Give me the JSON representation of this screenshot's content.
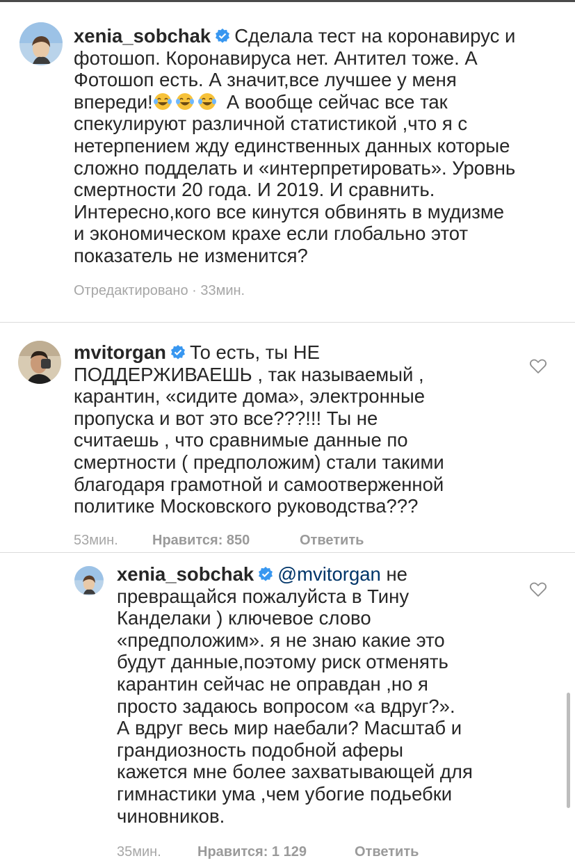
{
  "comments": [
    {
      "username": "xenia_sobchak",
      "lines": [
        "Сделала тест на коронавирус и",
        "фотошоп.  Коронавируса нет. Антител тоже. А",
        "Фотошоп есть. А значит,все лучшее  у меня",
        "впереди!",
        "А вообще сейчас все так",
        "спекулируют различной статистикой ,что я с",
        "нетерпением жду единственных данных которые",
        "сложно подделать и «интерпретировать». Уровнь",
        "смертности 20 года. И 2019. И сравнить.",
        "Интересно,кого  все кинутся обвинять в мудизме",
        "и экономическом крахе если глобально этот",
        "показатель  не изменится?"
      ],
      "meta": "Отредактировано · 33мин."
    },
    {
      "username": "mvitorgan",
      "lines": [
        "То есть, ты НЕ",
        "ПОДДЕРЖИВАЕШЬ , так называемый ,",
        "карантин, «сидите дома», электронные",
        "пропуска и вот это все???!!! Ты не",
        "считаешь , что сравнимые данные по",
        "смертности ( предположим) стали такими",
        "благодаря грамотной и самоотверженной",
        "политике Московского руководства???"
      ],
      "time": "53мин.",
      "likes": "Нравится: 850",
      "reply": "Ответить"
    },
    {
      "username": "xenia_sobchak",
      "mention": "@mvitorgan",
      "lines": [
        "не",
        "превращайся пожалуйста в Тину",
        "Канделаки ) ключевое слово",
        "«предположим». я не знаю какие это",
        "будут данные,поэтому риск отменять",
        "карантин сейчас не оправдан ,но я",
        "просто задаюсь вопросом «а вдруг?».",
        "А вдруг весь мир наебали? Масштаб и",
        "грандиозность подобной аферы",
        "кажется мне более захватывающей для",
        "гимнастики ума ,чем убогие подьебки",
        "чиновников."
      ],
      "time": "35мин.",
      "likes": "Нравится: 1 129",
      "reply": "Ответить"
    }
  ],
  "icons": {
    "verified": "verified-badge-icon",
    "heart": "heart-outline-icon",
    "emoji": "laughing-tears-emoji"
  },
  "colors": {
    "text": "#262626",
    "meta": "#a6a6a6",
    "verified": "#3897f0",
    "mention": "#003569",
    "divider": "#dbdbdb"
  }
}
